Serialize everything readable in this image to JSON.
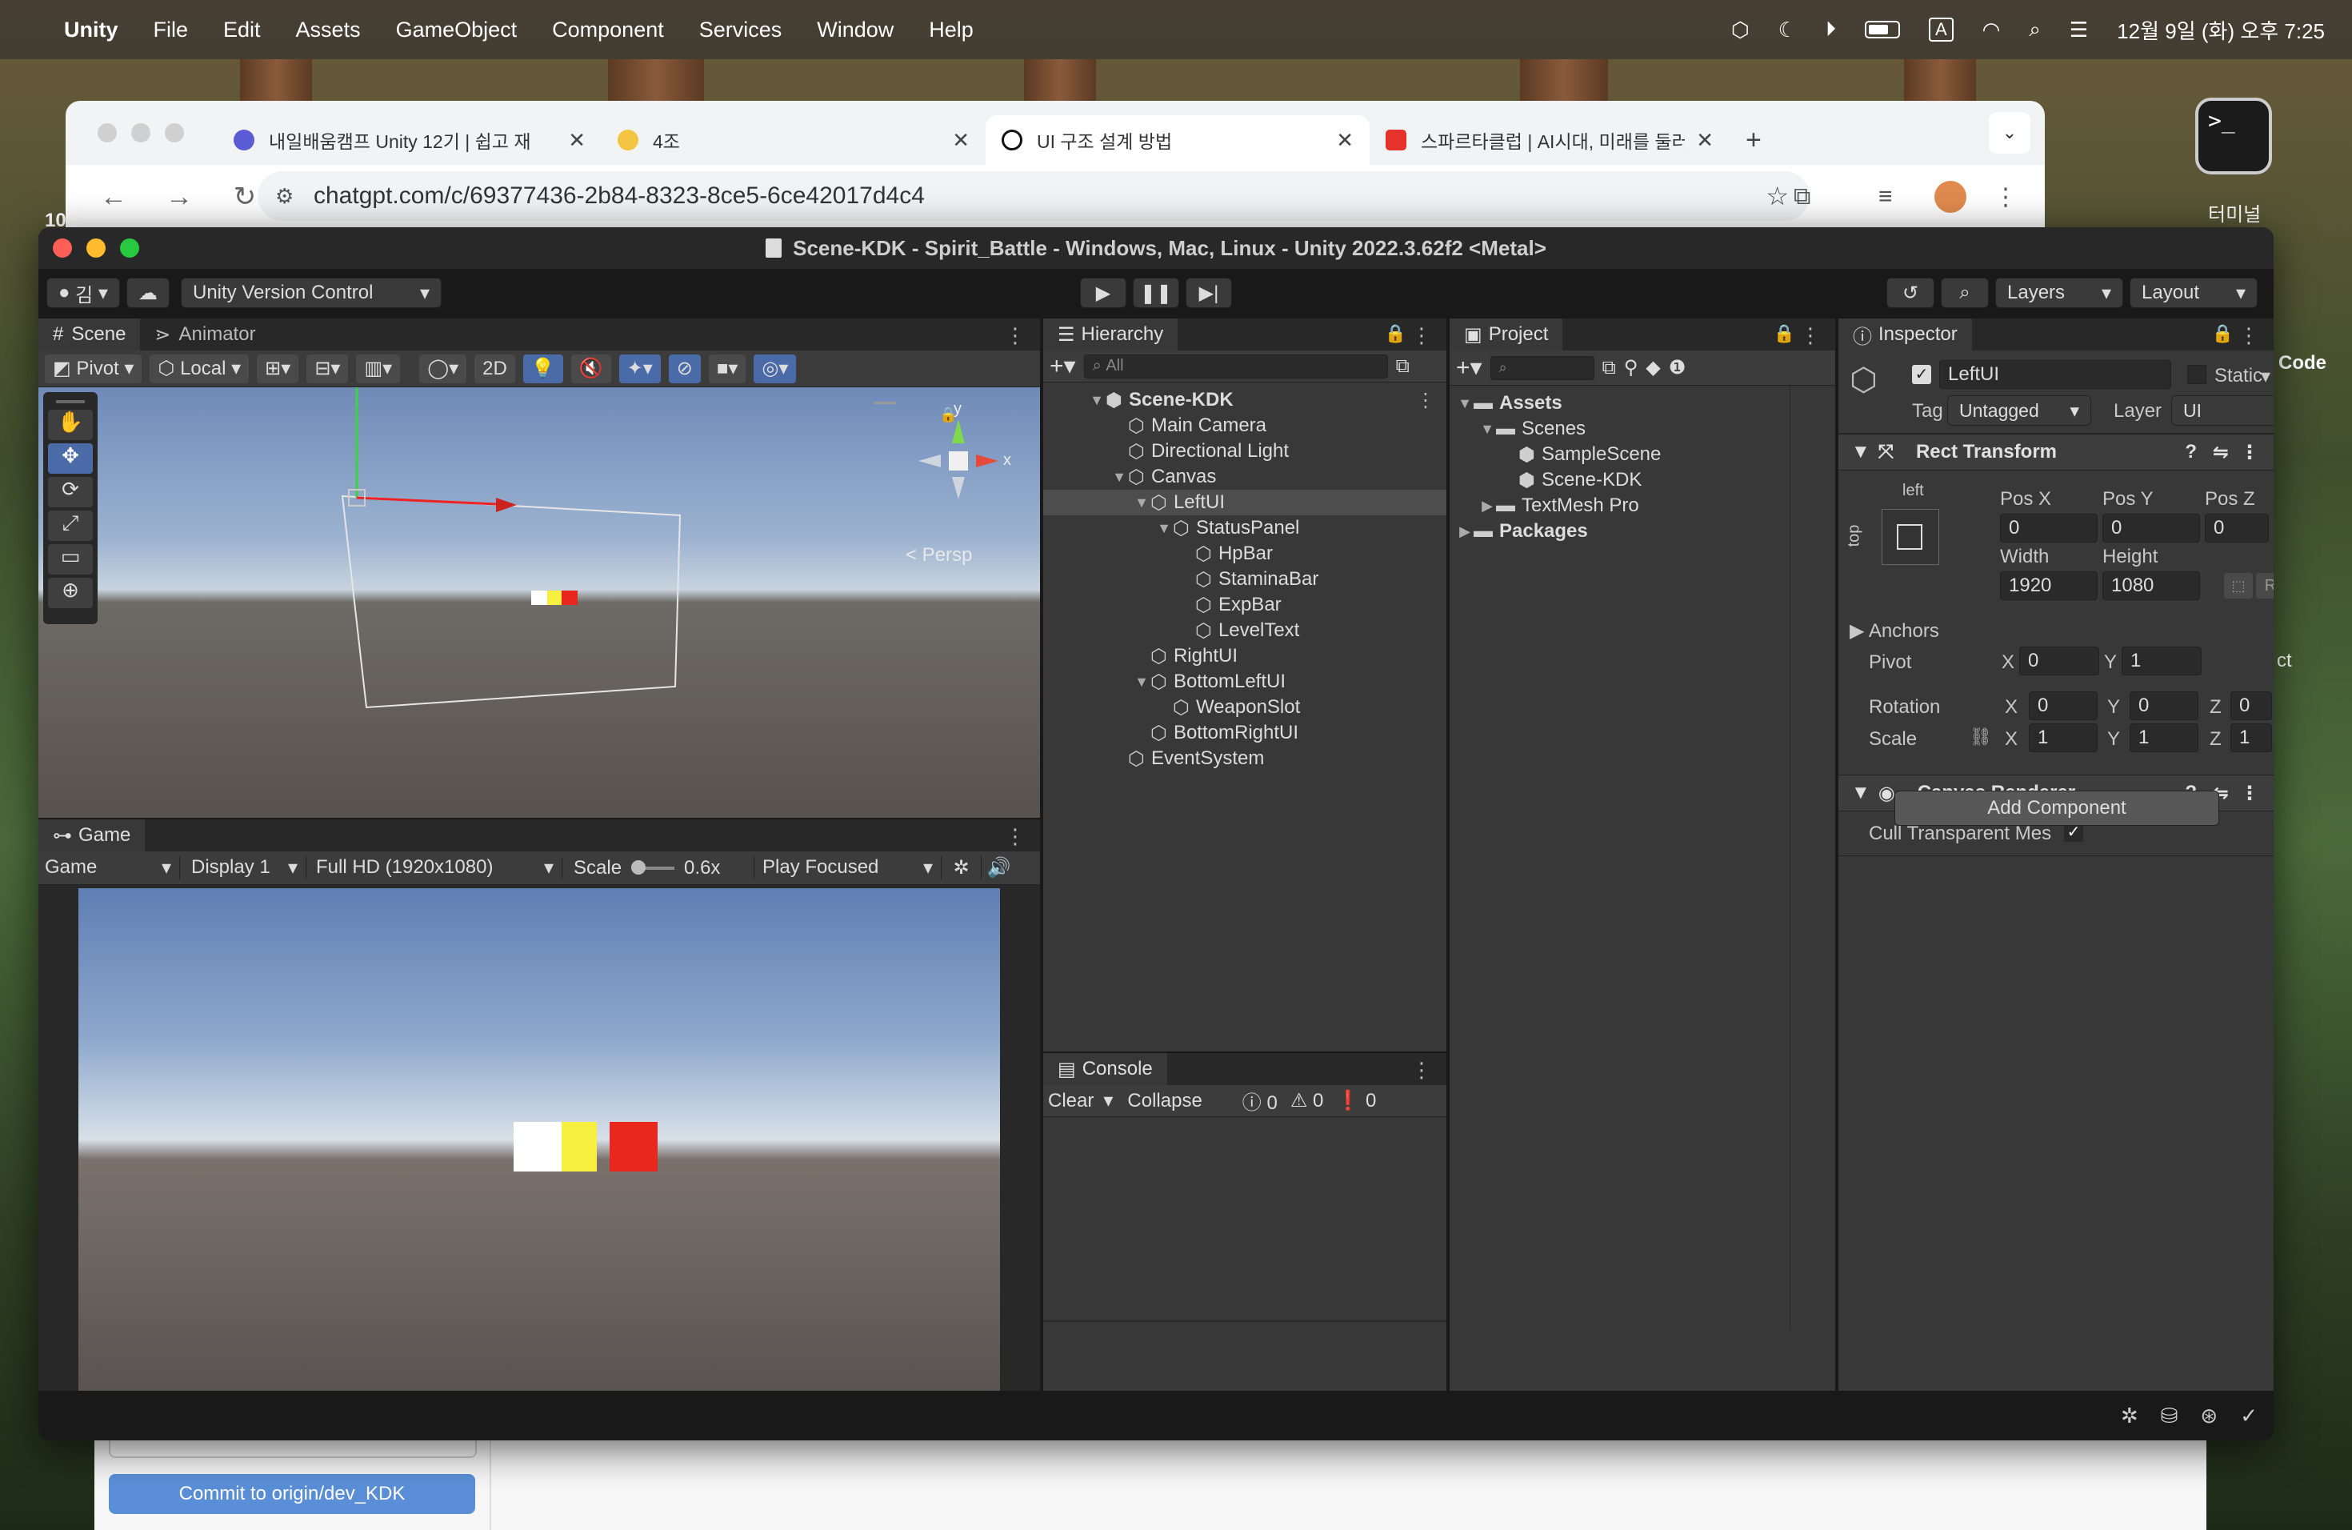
{
  "menubar": {
    "app": "Unity",
    "items": [
      "File",
      "Edit",
      "Assets",
      "GameObject",
      "Component",
      "Services",
      "Window",
      "Help"
    ],
    "clock": "12월 9일 (화) 오후 7:25",
    "input_indicator": "A"
  },
  "browser": {
    "tabs": [
      {
        "title": "내일배움캠프 Unity 12기 | 쉽고 재",
        "fav_color": "#5b5bd6"
      },
      {
        "title": "4조",
        "fav_color": "#f4c542"
      },
      {
        "title": "UI 구조 설계 방법",
        "fav_color": "#111111"
      },
      {
        "title": "스파르타클럽 | AI시대, 미래를 둘러",
        "fav_color": "#e5322d"
      }
    ],
    "url": "chatgpt.com/c/69377436-2b84-8323-8ce5-6ce42017d4c4"
  },
  "desktop": {
    "terminal_label": "터미널",
    "terminal_prompt": ">_",
    "side_code": "Code",
    "side_ct": "ct",
    "left_10": "10",
    "commit_button": "Commit to origin/dev_KDK"
  },
  "unity": {
    "title": "Scene-KDK - Spirit_Battle - Windows, Mac, Linux - Unity 2022.3.62f2 <Metal>",
    "toolbar": {
      "account": "김",
      "version_control": "Unity Version Control",
      "layers": "Layers",
      "layout": "Layout"
    },
    "scene": {
      "tabs": [
        "Scene",
        "Animator"
      ],
      "pivot": "Pivot",
      "local": "Local",
      "mode_2d": "2D",
      "persp": "< Persp",
      "gizmo_x": "x",
      "gizmo_y": "y"
    },
    "game": {
      "tab": "Game",
      "view": "Game",
      "display": "Display 1",
      "resolution": "Full HD (1920x1080)",
      "scale_label": "Scale",
      "scale_value": "0.6x",
      "play_mode": "Play Focused"
    },
    "hierarchy": {
      "tab": "Hierarchy",
      "search": "All",
      "rows": [
        {
          "label": "Scene-KDK",
          "indent": 0,
          "caret": "▼",
          "bold": true
        },
        {
          "label": "Main Camera",
          "indent": 1,
          "caret": ""
        },
        {
          "label": "Directional Light",
          "indent": 1,
          "caret": ""
        },
        {
          "label": "Canvas",
          "indent": 1,
          "caret": "▼"
        },
        {
          "label": "LeftUI",
          "indent": 2,
          "caret": "▼",
          "selected": true
        },
        {
          "label": "StatusPanel",
          "indent": 3,
          "caret": "▼"
        },
        {
          "label": "HpBar",
          "indent": 4,
          "caret": ""
        },
        {
          "label": "StaminaBar",
          "indent": 4,
          "caret": ""
        },
        {
          "label": "ExpBar",
          "indent": 4,
          "caret": ""
        },
        {
          "label": "LevelText",
          "indent": 4,
          "caret": ""
        },
        {
          "label": "RightUI",
          "indent": 2,
          "caret": ""
        },
        {
          "label": "BottomLeftUI",
          "indent": 2,
          "caret": "▼"
        },
        {
          "label": "WeaponSlot",
          "indent": 3,
          "caret": ""
        },
        {
          "label": "BottomRightUI",
          "indent": 2,
          "caret": ""
        },
        {
          "label": "EventSystem",
          "indent": 1,
          "caret": ""
        }
      ]
    },
    "project": {
      "tab": "Project",
      "rows": [
        {
          "label": "Assets",
          "indent": 0,
          "caret": "▼",
          "type": "folder",
          "bold": true
        },
        {
          "label": "Scenes",
          "indent": 1,
          "caret": "▼",
          "type": "folder"
        },
        {
          "label": "SampleScene",
          "indent": 2,
          "caret": "",
          "type": "scene"
        },
        {
          "label": "Scene-KDK",
          "indent": 2,
          "caret": "",
          "type": "scene"
        },
        {
          "label": "TextMesh Pro",
          "indent": 1,
          "caret": "▶",
          "type": "folder"
        },
        {
          "label": "Packages",
          "indent": 0,
          "caret": "▶",
          "type": "folder",
          "bold": true
        }
      ]
    },
    "console": {
      "tab": "Console",
      "clear": "Clear",
      "collapse": "Collapse",
      "info_count": "0",
      "warn_count": "0",
      "error_count": "0"
    },
    "inspector": {
      "tab": "Inspector",
      "object_name": "LeftUI",
      "static": "Static",
      "tag_label": "Tag",
      "tag": "Untagged",
      "layer_label": "Layer",
      "layer": "UI",
      "rect": {
        "title": "Rect Transform",
        "anchor_h": "left",
        "anchor_v": "top",
        "posx_label": "Pos X",
        "posy_label": "Pos Y",
        "posz_label": "Pos Z",
        "posx": "0",
        "posy": "0",
        "posz": "0",
        "width_label": "Width",
        "height_label": "Height",
        "width": "1920",
        "height": "1080",
        "r_btn": "R",
        "anchors": "Anchors",
        "pivot": "Pivot",
        "pivot_x": "0",
        "pivot_y": "1",
        "rotation": "Rotation",
        "rot_x": "0",
        "rot_y": "0",
        "rot_z": "0",
        "scale": "Scale",
        "scale_x": "1",
        "scale_y": "1",
        "scale_z": "1",
        "x": "X",
        "y": "Y",
        "z": "Z"
      },
      "canvas_renderer": {
        "title": "Canvas Renderer",
        "cull": "Cull Transparent Mes"
      },
      "add_component": "Add Component"
    }
  },
  "colors": {
    "unity_bg": "#383838",
    "selection": "#4d4d4d",
    "hp": "#ffffff",
    "stamina": "#f8f040",
    "exp": "#e8281e"
  }
}
